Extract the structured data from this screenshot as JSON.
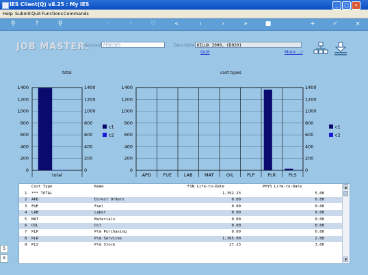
{
  "window": {
    "title": "IES Client(Q) v8.25 : My IES",
    "min": "_",
    "max": "□",
    "close": "×"
  },
  "menu": [
    "Help",
    "Submit",
    "Quit",
    "Functions",
    "Commands"
  ],
  "toolbar_icons": [
    "key-icon",
    "help-icon",
    "search-icon",
    "icon-4",
    "icon-5",
    "heart-icon",
    "rewind-icon",
    "prev-icon",
    "next-icon",
    "forward-icon",
    "stop-icon",
    "new-icon",
    "ok-icon",
    "close-icon"
  ],
  "header": {
    "title": "JOB MASTER:",
    "account_label": "Account",
    "account_value": "PEN1363",
    "description_label": "Description",
    "description_value": "KILUX 2000, CD0201",
    "quit_link": "Quit",
    "more_link": "More .../"
  },
  "chart_data": [
    {
      "type": "bar",
      "title": "total",
      "categories": [
        "total"
      ],
      "series": [
        {
          "name": "c1",
          "values": [
            1392.23
          ]
        },
        {
          "name": "c2",
          "values": [
            5.0
          ]
        }
      ],
      "ylim": [
        0,
        1400
      ],
      "yticks": [
        0,
        200,
        400,
        600,
        800,
        1000,
        1200,
        1400
      ],
      "legend": "right",
      "colors": {
        "c1": "#0a0a6e",
        "c2": "#1a1ad6"
      },
      "grid": true
    },
    {
      "type": "bar",
      "title": "cost types",
      "categories": [
        "APD",
        "FUE",
        "LAB",
        "MAT",
        "OIL",
        "PLP",
        "PLR",
        "PLS"
      ],
      "series": [
        {
          "name": "c1",
          "values": [
            0,
            0,
            0,
            0,
            0,
            0,
            1365.0,
            27.23
          ]
        },
        {
          "name": "c2",
          "values": [
            0,
            0,
            0,
            0,
            0,
            0,
            2.0,
            3.0
          ]
        }
      ],
      "ylim": [
        0,
        1400
      ],
      "yticks": [
        0,
        200,
        400,
        600,
        800,
        1000,
        1200,
        1400
      ],
      "legend": "right",
      "colors": {
        "c1": "#0a0a6e",
        "c2": "#1a1ad6"
      },
      "grid": true
    }
  ],
  "table": {
    "columns": [
      "Cost Type",
      "Name",
      "FIN Life-to-Date",
      "PHYS Life-to-Date"
    ],
    "rows": [
      {
        "n": "1",
        "type": "*** TOTAL",
        "name": "",
        "fin": "1,392.23",
        "phys": "5.00"
      },
      {
        "n": "2",
        "type": "APD",
        "name": "Direct Orders",
        "fin": "0.00",
        "phys": "0.00"
      },
      {
        "n": "3",
        "type": "FUE",
        "name": "Fuel",
        "fin": "0.00",
        "phys": "0.00"
      },
      {
        "n": "4",
        "type": "LAB",
        "name": "Labor",
        "fin": "0.00",
        "phys": "0.00"
      },
      {
        "n": "5",
        "type": "MAT",
        "name": "Materials",
        "fin": "0.00",
        "phys": "0.00"
      },
      {
        "n": "6",
        "type": "OIL",
        "name": "Oil",
        "fin": "0.00",
        "phys": "0.00"
      },
      {
        "n": "7",
        "type": "PLP",
        "name": "Plm Purchasing",
        "fin": "0.00",
        "phys": "0.00"
      },
      {
        "n": "8",
        "type": "PLR",
        "name": "Plm Services",
        "fin": "1,365.00",
        "phys": "2.00"
      },
      {
        "n": "9",
        "type": "PLS",
        "name": "Plm Stock",
        "fin": "27.23",
        "phys": "3.00"
      }
    ],
    "side_markers": [
      "S",
      "X"
    ]
  }
}
